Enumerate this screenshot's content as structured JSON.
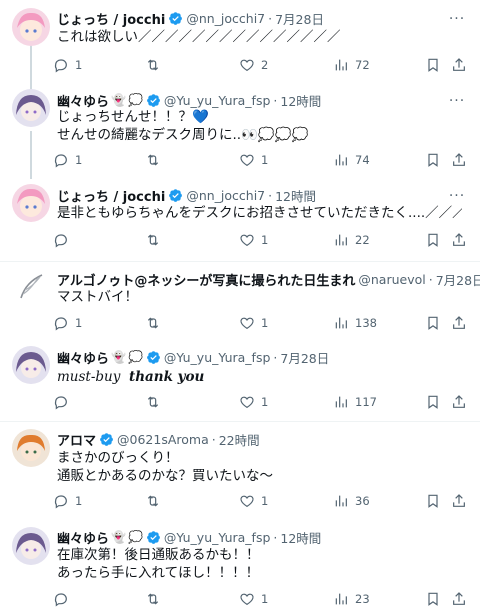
{
  "tweets": [
    {
      "name": "じょっち / jocchi",
      "handle": "@nn_jocchi7",
      "time": "7月28日",
      "lines": [
        "これは欲しい／／／／／／／／／／／／／／／"
      ],
      "reply": "1",
      "retweet": "",
      "like": "2",
      "views": "72",
      "avatar": "pink-hair-avatar"
    },
    {
      "name": "幽々ゆら",
      "handle": "@Yu_yu_Yura_fsp",
      "time": "12時間",
      "lines": [
        "じょっちせんせ！！？",
        "せんせの綺麗なデスク周りに.."
      ],
      "heart": "💙",
      "line2_tail": "👀💭💭💭",
      "reply": "1",
      "retweet": "",
      "like": "1",
      "views": "74",
      "avatar": "purple-hair-avatar"
    },
    {
      "name": "じょっち / jocchi",
      "handle": "@nn_jocchi7",
      "time": "12時間",
      "lines": [
        "是非ともゆらちゃんをデスクにお招きさせていただきたく....／／／／"
      ],
      "sparkles": "✨✨✨✨",
      "reply": "",
      "retweet": "",
      "like": "1",
      "views": "22",
      "avatar": "pink-hair-avatar"
    },
    {
      "name": "アルゴノゥト@ネッシーが写真に撮られた日生まれ",
      "handle": "@naruevol",
      "time": "7月28日",
      "lines": [
        "マストバイ！"
      ],
      "reply": "1",
      "retweet": "",
      "like": "1",
      "views": "138",
      "avatar": "feather-avatar"
    },
    {
      "name": "幽々ゆら",
      "handle": "@Yu_yu_Yura_fsp",
      "time": "7月28日",
      "lines": [
        "must-buy",
        "thank you"
      ],
      "reply": "",
      "retweet": "",
      "like": "1",
      "views": "117",
      "avatar": "purple-hair-avatar"
    },
    {
      "name": "アロマ",
      "handle": "@0621sAroma",
      "time": "22時間",
      "lines": [
        "まさかのびっくり！",
        "通販とかあるのかな？買いたいな〜"
      ],
      "reply": "1",
      "retweet": "",
      "like": "1",
      "views": "36",
      "avatar": "orange-hair-avatar"
    },
    {
      "name": "幽々ゆら",
      "handle": "@Yu_yu_Yura_fsp",
      "time": "12時間",
      "lines": [
        "在庫次第！後日通販あるかも！！",
        "あったら手に入れてほし！！！！"
      ],
      "reply": "",
      "retweet": "",
      "like": "1",
      "views": "23",
      "avatar": "purple-hair-avatar"
    }
  ],
  "sep": "·",
  "more_label": "···",
  "colors": {
    "verified": "#1d9bf0",
    "text": "#0f1419",
    "muted": "#536471"
  }
}
